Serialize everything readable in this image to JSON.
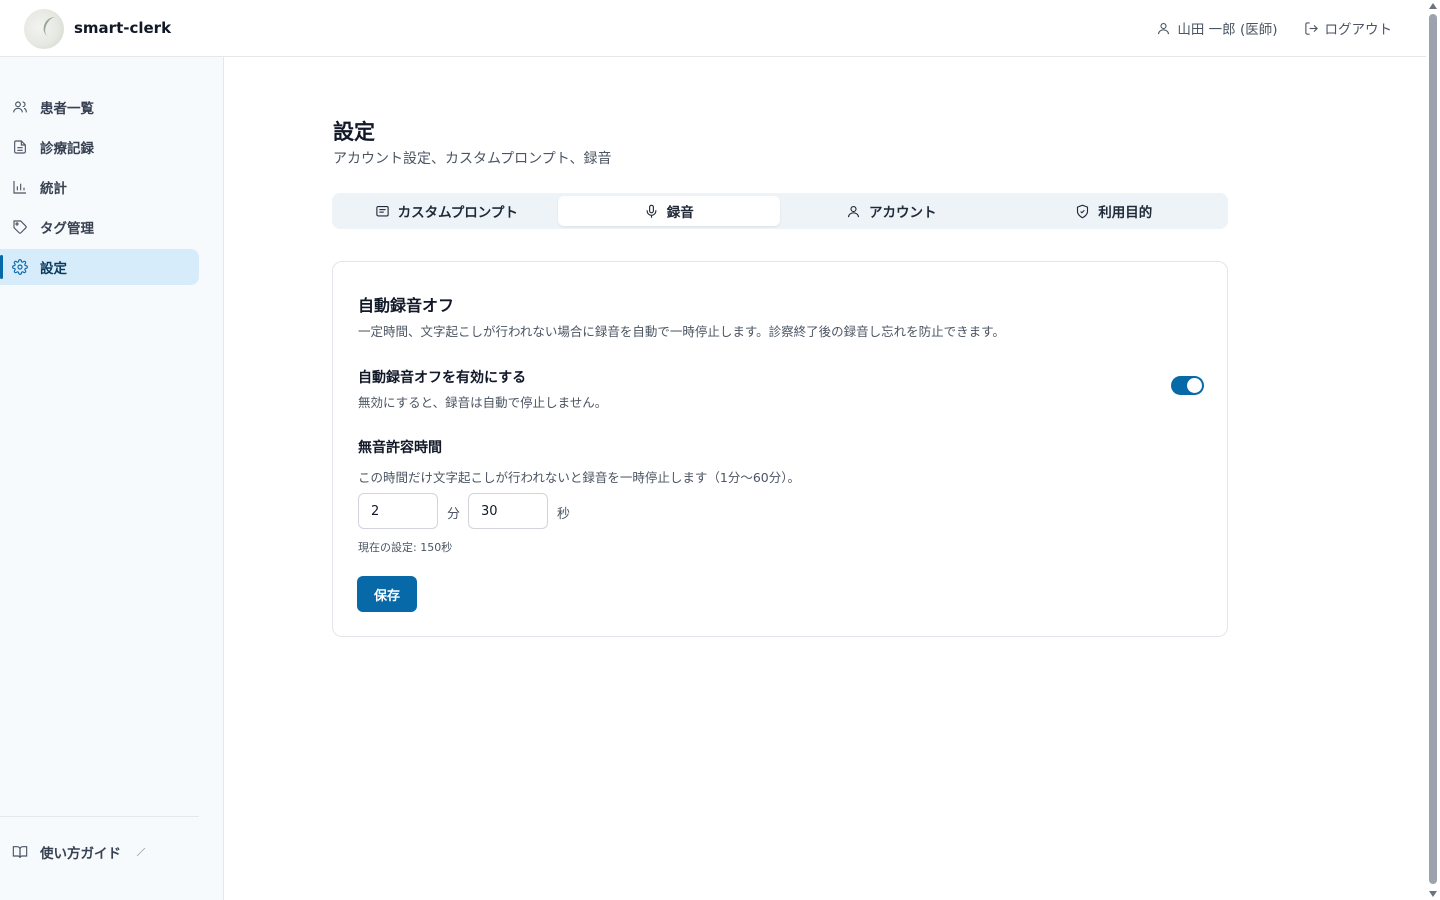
{
  "header": {
    "app_title": "smart-clerk",
    "user_label": "山田 一郎 (医師)",
    "logout_label": "ログアウト"
  },
  "sidebar": {
    "items": [
      {
        "label": "患者一覧",
        "icon": "users-icon"
      },
      {
        "label": "診療記録",
        "icon": "file-text-icon"
      },
      {
        "label": "統計",
        "icon": "bar-chart-icon"
      },
      {
        "label": "タグ管理",
        "icon": "tag-icon"
      },
      {
        "label": "設定",
        "icon": "gear-icon",
        "active": true
      }
    ],
    "guide_label": "使い方ガイド"
  },
  "main": {
    "title": "設定",
    "subtitle": "アカウント設定、カスタムプロンプト、録音",
    "tabs": [
      {
        "label": "カスタムプロンプト",
        "icon": "message-square-icon"
      },
      {
        "label": "録音",
        "icon": "mic-icon",
        "active": true
      },
      {
        "label": "アカウント",
        "icon": "user-icon"
      },
      {
        "label": "利用目的",
        "icon": "shield-check-icon"
      }
    ],
    "card": {
      "title": "自動録音オフ",
      "description": "一定時間、文字起こしが行われない場合に録音を自動で一時停止します。診察終了後の録音し忘れを防止できます。",
      "toggle_label": "自動録音オフを有効にする",
      "toggle_description": "無効にすると、録音は自動で停止しません。",
      "toggle_on": true,
      "silence_label": "無音許容時間",
      "silence_description": "この時間だけ文字起こしが行われないと録音を一時停止します（1分〜60分）。",
      "minutes_value": "2",
      "minutes_unit": "分",
      "seconds_value": "30",
      "seconds_unit": "秒",
      "current_setting": "現在の設定: 150秒",
      "save_label": "保存"
    }
  },
  "colors": {
    "accent": "#0869a8",
    "active_nav_bg": "#d7ecfb",
    "sidebar_bg": "#f7fafd"
  }
}
